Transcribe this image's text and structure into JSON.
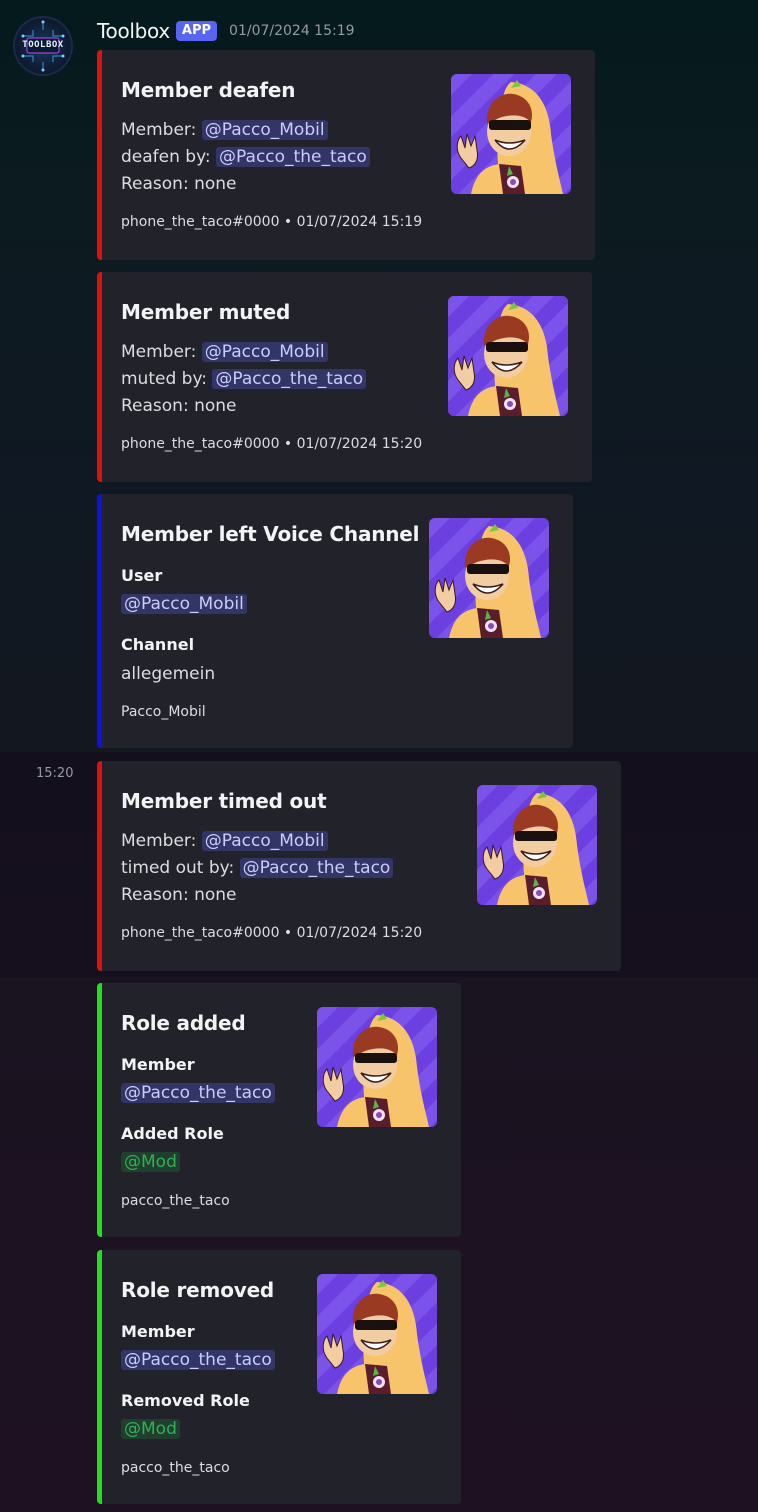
{
  "message": {
    "author": "Toolbox",
    "badge": "APP",
    "timestamp": "01/07/2024 15:19",
    "avatar_text": "TOOLBOX",
    "side_time": "15:20"
  },
  "colors": {
    "red_bar": "#e01010",
    "blue_bar": "#1010e0",
    "green_bar": "#20e020",
    "app_badge": "#5865f2"
  },
  "embeds": [
    {
      "title": "Member deafen",
      "lines": [
        {
          "label": "Member: ",
          "mention": "@Pacco_Mobil"
        },
        {
          "label": "deafen by: ",
          "mention": "@Pacco_the_taco"
        },
        {
          "label": "Reason: none"
        }
      ],
      "footer": "phone_the_taco#0000 • 01/07/2024 15:19"
    },
    {
      "title": "Member muted",
      "lines": [
        {
          "label": "Member: ",
          "mention": "@Pacco_Mobil"
        },
        {
          "label": "muted by: ",
          "mention": "@Pacco_the_taco"
        },
        {
          "label": "Reason: none"
        }
      ],
      "footer": "phone_the_taco#0000 • 01/07/2024 15:20"
    },
    {
      "title": "Member left Voice Channel",
      "fields": [
        {
          "name": "User",
          "mention": "@Pacco_Mobil"
        },
        {
          "name": "Channel",
          "value": "allegemein"
        }
      ],
      "footer": "Pacco_Mobil"
    },
    {
      "title": "Member timed out",
      "lines": [
        {
          "label": "Member: ",
          "mention": "@Pacco_Mobil"
        },
        {
          "label": "timed out by: ",
          "mention": "@Pacco_the_taco"
        },
        {
          "label": "Reason: none"
        }
      ],
      "footer": "phone_the_taco#0000 • 01/07/2024 15:20"
    },
    {
      "title": "Role added",
      "fields": [
        {
          "name": "Member",
          "mention": "@Pacco_the_taco"
        },
        {
          "name": "Added Role",
          "role": "@Mod"
        }
      ],
      "footer": "pacco_the_taco"
    },
    {
      "title": "Role removed",
      "fields": [
        {
          "name": "Member",
          "mention": "@Pacco_the_taco"
        },
        {
          "name": "Removed Role",
          "role": "@Mod"
        }
      ],
      "footer": "pacco_the_taco"
    }
  ],
  "thumbnail_icon": "waving-character-icon"
}
